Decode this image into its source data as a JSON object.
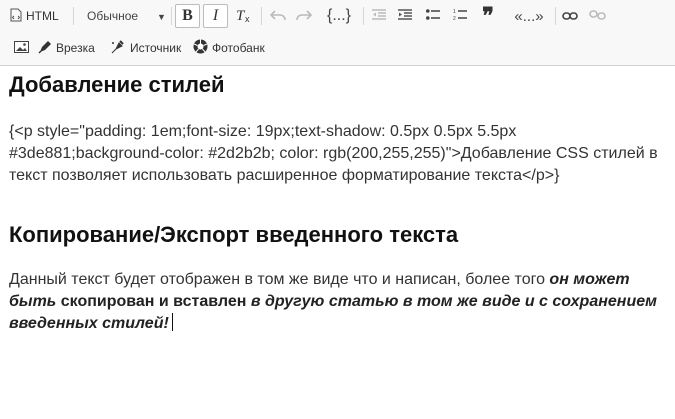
{
  "toolbar": {
    "html_label": "HTML",
    "format_value": "Обычное",
    "bold": "B",
    "italic": "I",
    "clear_format": "Tx",
    "code_label": "{...}",
    "quote": "❞",
    "quote_label": "«...»",
    "insert_label": "Врезка",
    "source_label": "Источник",
    "photobank_label": "Фотобанк"
  },
  "content": {
    "heading1": "Добавление стилей",
    "paragraph1": "{<p style=\"padding: 1em;font-size: 19px;text-shadow: 0.5px 0.5px 5.5px #3de881;background-color: #2d2b2b; color: rgb(200,255,255)\">Добавление CSS стилей в текст позволяет использовать расширенное форматирование текста</p>}",
    "heading2": "Копирование/Экспорт введенного текста",
    "paragraph2": {
      "plain1": "Данный текст будет отображен в том же виде что и написан, более того ",
      "bi1": "он может быть",
      "b1": " скопирован и вставлен",
      "bi2": " в другую статью в том же виде и с сохранением введенных стилей!"
    }
  }
}
